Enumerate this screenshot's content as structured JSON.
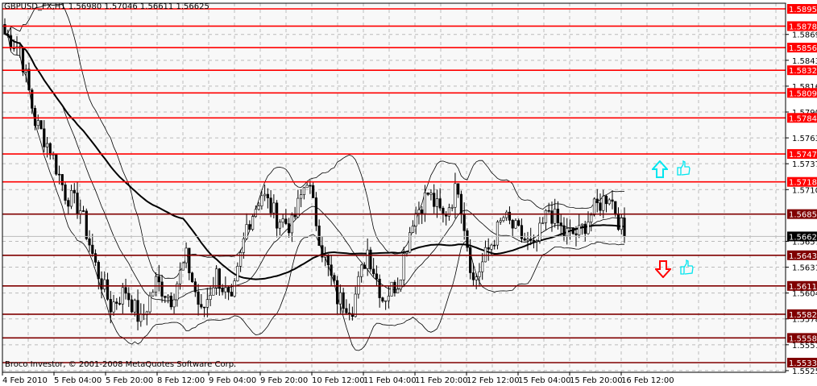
{
  "header": {
    "symbol": "GBPUSD_FX,H1",
    "ohlc": "1.56980 1.57046 1.56611 1.56625"
  },
  "footer": {
    "copyright": "Broco Investor, © 2001-2008 MetaQuotes Software Corp."
  },
  "colors": {
    "background": "#f8f8f8",
    "resistance": "#ff0000",
    "support": "#800000",
    "current": "#000000",
    "signal_up": "#00e5ee",
    "signal_down": "#ff0000"
  },
  "signals": {
    "up": "arrow-up-icon + thumbs-up-icon",
    "down": "arrow-down-icon + thumbs-up-icon"
  },
  "chart_data": {
    "type": "candlestick",
    "title": "GBPUSD_FX,H1",
    "ylim": [
      1.552,
      1.5906
    ],
    "price_ticks": [
      "1.58695",
      "1.58430",
      "1.58165",
      "1.57900",
      "1.57635",
      "1.57370",
      "1.57105",
      "1.56575",
      "1.56310",
      "1.56045",
      "1.55780",
      "1.55515",
      "1.55250"
    ],
    "time_labels": [
      "4 Feb 2010",
      "5 Feb 04:00",
      "5 Feb 20:00",
      "8 Feb 12:00",
      "9 Feb 04:00",
      "9 Feb 20:00",
      "10 Feb 12:00",
      "11 Feb 04:00",
      "11 Feb 20:00",
      "12 Feb 12:00",
      "15 Feb 04:00",
      "15 Feb 20:00",
      "16 Feb 12:00"
    ],
    "resistance_levels": [
      "1.58957",
      "1.58780",
      "1.58560",
      "1.58328",
      "1.58096",
      "1.57840",
      "1.57470",
      "1.57184"
    ],
    "support_levels": [
      "1.56854",
      "1.56432",
      "1.56118",
      "1.55828",
      "1.55585",
      "1.55332"
    ],
    "current_price": "1.56625",
    "approx_closes": [
      1.587,
      1.58552,
      1.57809,
      1.5752,
      1.57066,
      1.56901,
      1.56323,
      1.5591,
      1.56075,
      1.55745,
      1.56158,
      1.55993,
      1.56405,
      1.55827,
      1.5624,
      1.5591,
      1.56736,
      1.57066,
      1.56818,
      1.56736,
      1.57231,
      1.56488,
      1.55993,
      1.5591,
      1.56488,
      1.55993,
      1.56158,
      1.56818,
      1.57066,
      1.56818,
      1.57149,
      1.56158,
      1.56488,
      1.56818,
      1.56653,
      1.56488,
      1.56901,
      1.56653,
      1.56653,
      1.56901,
      1.57066,
      1.56625
    ],
    "indicators": [
      "Moving Average",
      "Bollinger Bands"
    ]
  }
}
